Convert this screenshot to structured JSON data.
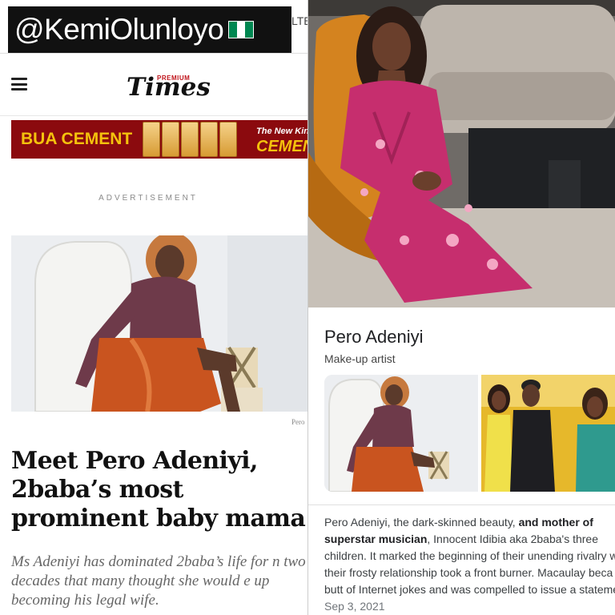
{
  "watermark": {
    "handle": "@KemiOlunloyo",
    "status_fragment": "LTE",
    "flag_colors": [
      "#008751",
      "#ffffff",
      "#008751"
    ]
  },
  "left_article": {
    "logo_premium": "PREMIUM",
    "logo_times": "Times",
    "banner": {
      "brand": "BUA CEMENT",
      "tag_line1": "The New Kin",
      "tag_line2": "CEMEN",
      "brand_color": "#f4c20d",
      "bg_color": "#8b0a0e"
    },
    "ad_label": "ADVERTISEMENT",
    "photo_caption": "Pero",
    "headline": "Meet Pero Adeniyi, 2baba’s most prominent baby mama",
    "subtext": "Ms Adeniyi has dominated 2baba’s life for n two decades that many thought she would e up becoming his legal wife."
  },
  "right_result": {
    "name": "Pero Adeniyi",
    "role": "Make-up artist",
    "snippet": {
      "part1": "Pero Adeniyi, the dark-skinned beauty, ",
      "bold": "and mother of superstar musician",
      "part2": ", Innocent Idibia aka 2baba's three children. It marked the beginning of their unending rivalry w their frosty relationship took a front burner. Macaulay beca the butt of Internet jokes and was compelled to issue a statement.",
      "date": "Sep 3, 2021"
    }
  }
}
